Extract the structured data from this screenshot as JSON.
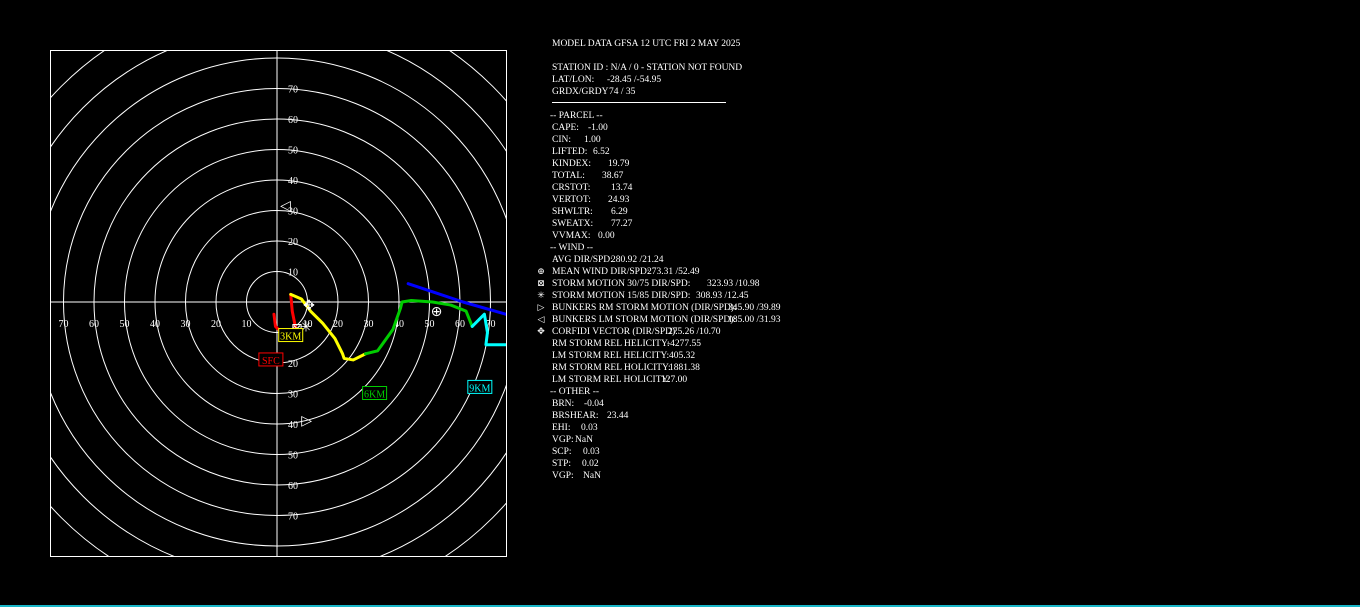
{
  "header": {
    "title": "MODEL DATA GFSA 12 UTC FRI 2 MAY 2025"
  },
  "station": {
    "id_line": "STATION ID :  N/A  /    0   - STATION NOT FOUND",
    "latlon_label": "LAT/LON:",
    "latlon_value": "-28.45 /-54.95",
    "grd_label": "GRDX/GRDY",
    "grd_value": "74 /   35"
  },
  "parcel": {
    "header": "-- PARCEL --",
    "rows": [
      {
        "label": "CAPE:",
        "value": "-1.00"
      },
      {
        "label": "CIN:",
        "value": "1.00"
      },
      {
        "label": "LIFTED:",
        "value": "6.52"
      },
      {
        "label": "KINDEX:",
        "value": "19.79"
      },
      {
        "label": "TOTAL:",
        "value": "38.67"
      },
      {
        "label": "CRSTOT:",
        "value": "13.74"
      },
      {
        "label": "VERTOT:",
        "value": "24.93"
      },
      {
        "label": "SHWLTR:",
        "value": "6.29"
      },
      {
        "label": "SWEATX:",
        "value": "77.27"
      },
      {
        "label": "VVMAX:",
        "value": "0.00"
      }
    ]
  },
  "wind": {
    "header": "-- WIND --",
    "rows": [
      {
        "icon": "",
        "icon_name": "",
        "label": "AVG DIR/SPD:",
        "value": "280.92 /21.24"
      },
      {
        "icon": "⊕",
        "icon_name": "mean-wind-icon",
        "label": "MEAN WIND DIR/SPD:",
        "value": "273.31 /52.49"
      },
      {
        "icon": "⊠",
        "icon_name": "storm-motion-3075-icon",
        "label": "STORM MOTION 30/75 DIR/SPD:",
        "value": "323.93 /10.98"
      },
      {
        "icon": "✳",
        "icon_name": "storm-motion-1585-icon",
        "label": "STORM MOTION 15/85 DIR/SPD:",
        "value": "308.93 /12.45"
      },
      {
        "icon": "▷",
        "icon_name": "bunkers-rm-icon",
        "label": "BUNKERS RM STORM MOTION (DIR/SPD):",
        "value": "345.90 /39.89"
      },
      {
        "icon": "◁",
        "icon_name": "bunkers-lm-icon",
        "label": "BUNKERS LM STORM MOTION (DIR/SPD):",
        "value": "185.00 /31.93"
      },
      {
        "icon": "✥",
        "icon_name": "corfidi-vector-icon",
        "label": "CORFIDI VECTOR (DIR/SPD):",
        "value": "275.26 /10.70"
      },
      {
        "icon": "",
        "icon_name": "",
        "label": "RM STORM REL HELICITY:",
        "value": "-4277.55"
      },
      {
        "icon": "",
        "icon_name": "",
        "label": "LM STORM REL HELICITY:",
        "value": "405.32"
      },
      {
        "icon": "",
        "icon_name": "",
        "label": "RM STORM REL HOLICITY:",
        "value": "1881.38"
      },
      {
        "icon": "",
        "icon_name": "",
        "label": "LM STORM REL HOLICITY:",
        "value": "127.00"
      }
    ]
  },
  "other": {
    "header": "-- OTHER --",
    "rows": [
      {
        "label": "BRN:",
        "value": "-0.04"
      },
      {
        "label": "BRSHEAR:",
        "value": "23.44"
      },
      {
        "label": "EHI:",
        "value": "0.03"
      },
      {
        "label": "VGP:",
        "value": "NaN"
      },
      {
        "label": "SCP:",
        "value": "0.03"
      },
      {
        "label": "STP:",
        "value": "0.02"
      },
      {
        "label": "VGP:",
        "value": "NaN"
      }
    ]
  },
  "chart_data": {
    "type": "hodograph",
    "rings": [
      10,
      20,
      30,
      40,
      50,
      60,
      70
    ],
    "ring_labels": [
      "10",
      "20",
      "30",
      "40",
      "50",
      "60",
      "70"
    ],
    "x_tick_labels": [
      "70",
      "60",
      "50",
      "40",
      "30",
      "20",
      "10",
      "10",
      "20",
      "30",
      "40",
      "50",
      "60",
      "70"
    ],
    "y_tick_labels": [
      "70",
      "60",
      "50",
      "40",
      "30",
      "20",
      "10",
      "10",
      "20",
      "30",
      "40",
      "50",
      "60",
      "70"
    ],
    "axis_range": [
      -75,
      75
    ],
    "grid": true,
    "colors": {
      "background": "#000000",
      "grid": "#ffffff",
      "0-3km": "#ff0000",
      "3-6km": "#ffff00",
      "6-9km": "#00cc00",
      "9km+": "#00ffff",
      "upper": "#0000ff",
      "label_3km": "#ffff00",
      "label_6km": "#00cc00",
      "label_9km": "#00ffff",
      "label_sfc": "#ff0000"
    },
    "segments": [
      {
        "layer": "0-3km",
        "color": "#ff0000",
        "points": [
          [
            -1,
            -4
          ],
          [
            -0.5,
            -8
          ],
          [
            1,
            -9.5
          ],
          [
            4,
            -10
          ],
          [
            6,
            -10.5
          ],
          [
            6,
            -8
          ],
          [
            5,
            -3
          ],
          [
            4.5,
            2.5
          ]
        ]
      },
      {
        "layer": "3-6km",
        "color": "#ffff00",
        "points": [
          [
            4.5,
            2.5
          ],
          [
            8,
            1
          ],
          [
            11,
            -3
          ],
          [
            15,
            -7
          ],
          [
            19,
            -12
          ],
          [
            21.5,
            -17
          ],
          [
            22,
            -18.5
          ],
          [
            25,
            -19
          ],
          [
            29,
            -17
          ]
        ]
      },
      {
        "layer": "6-9km",
        "color": "#00cc00",
        "points": [
          [
            29,
            -17
          ],
          [
            33,
            -16
          ],
          [
            38,
            -9
          ],
          [
            40.5,
            -2
          ],
          [
            41,
            0
          ],
          [
            44,
            0.5
          ],
          [
            51,
            0
          ],
          [
            57,
            -1
          ],
          [
            62,
            -3
          ],
          [
            64,
            -8
          ]
        ]
      },
      {
        "layer": "9km+",
        "color": "#00ffff",
        "points": [
          [
            64,
            -8
          ],
          [
            68,
            -4
          ],
          [
            69,
            -10
          ],
          [
            68.5,
            -14
          ],
          [
            71,
            -14
          ],
          [
            75,
            -14
          ]
        ]
      },
      {
        "layer": "upper",
        "color": "#0000ff",
        "points": [
          [
            43,
            6
          ],
          [
            52,
            3
          ],
          [
            61,
            0
          ],
          [
            75,
            -4
          ]
        ]
      }
    ],
    "height_labels": [
      {
        "text": "SFC",
        "color": "#ff0000",
        "x": -2,
        "y": -19
      },
      {
        "text": "3KM",
        "color": "#ffff00",
        "x": 4.5,
        "y": -11
      },
      {
        "text": "6KM",
        "color": "#00cc00",
        "x": 32,
        "y": -30
      },
      {
        "text": "9KM",
        "color": "#00ffff",
        "x": 66.5,
        "y": -28
      }
    ],
    "markers": [
      {
        "name": "mean-wind",
        "glyph": "⊕",
        "x": 52.3,
        "y": -3
      },
      {
        "name": "storm-motion-3075",
        "glyph": "⊠",
        "x": 6.5,
        "y": -8.5
      },
      {
        "name": "storm-motion-1585",
        "glyph": "✳",
        "x": 9.5,
        "y": -8
      },
      {
        "name": "bunkers-rm",
        "glyph": "▷",
        "x": 9.7,
        "y": -38.7
      },
      {
        "name": "bunkers-lm",
        "glyph": "◁",
        "x": 2.8,
        "y": 31.8
      },
      {
        "name": "corfidi",
        "glyph": "✥",
        "x": 10.5,
        "y": -1
      }
    ]
  }
}
